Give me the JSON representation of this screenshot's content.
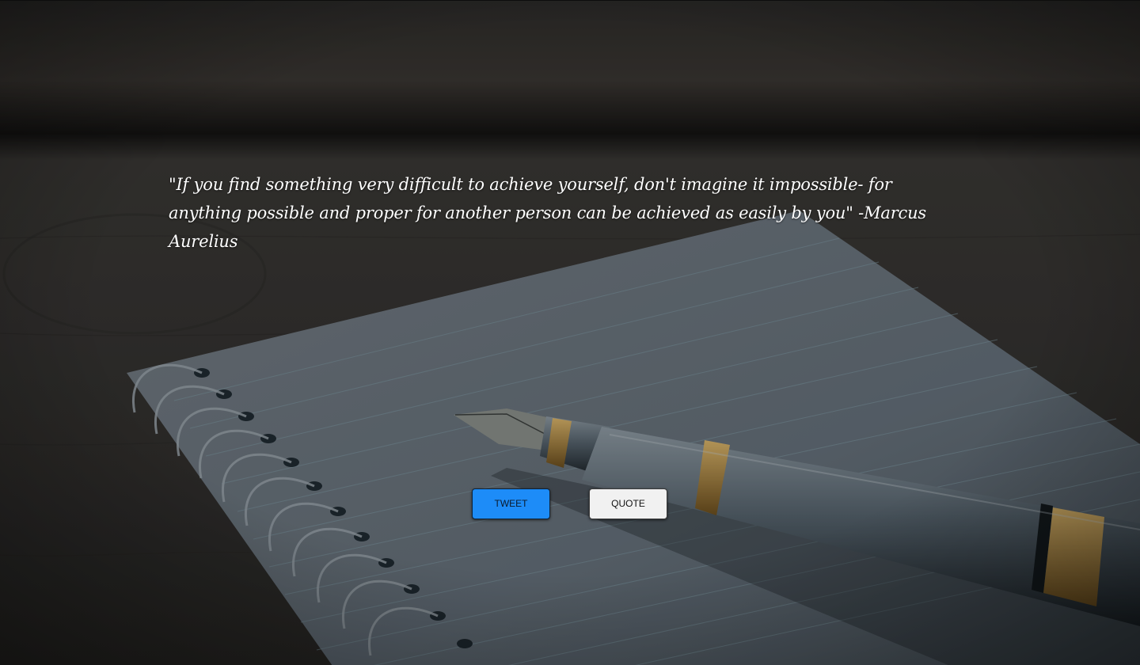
{
  "quote": {
    "text": "\"If you find something very difficult to achieve yourself, don't imagine it impossible- for anything possible and proper for another person can be achieved as easily by you\" -Marcus Aurelius"
  },
  "buttons": {
    "tweet_label": "TWEET",
    "quote_label": "QUOTE"
  },
  "colors": {
    "tweet_button": "#1d8cf8",
    "quote_button": "#f1f1f1",
    "quote_text": "#ffffff"
  },
  "background": {
    "scene": "notebook-and-fountain-pen-photo"
  }
}
